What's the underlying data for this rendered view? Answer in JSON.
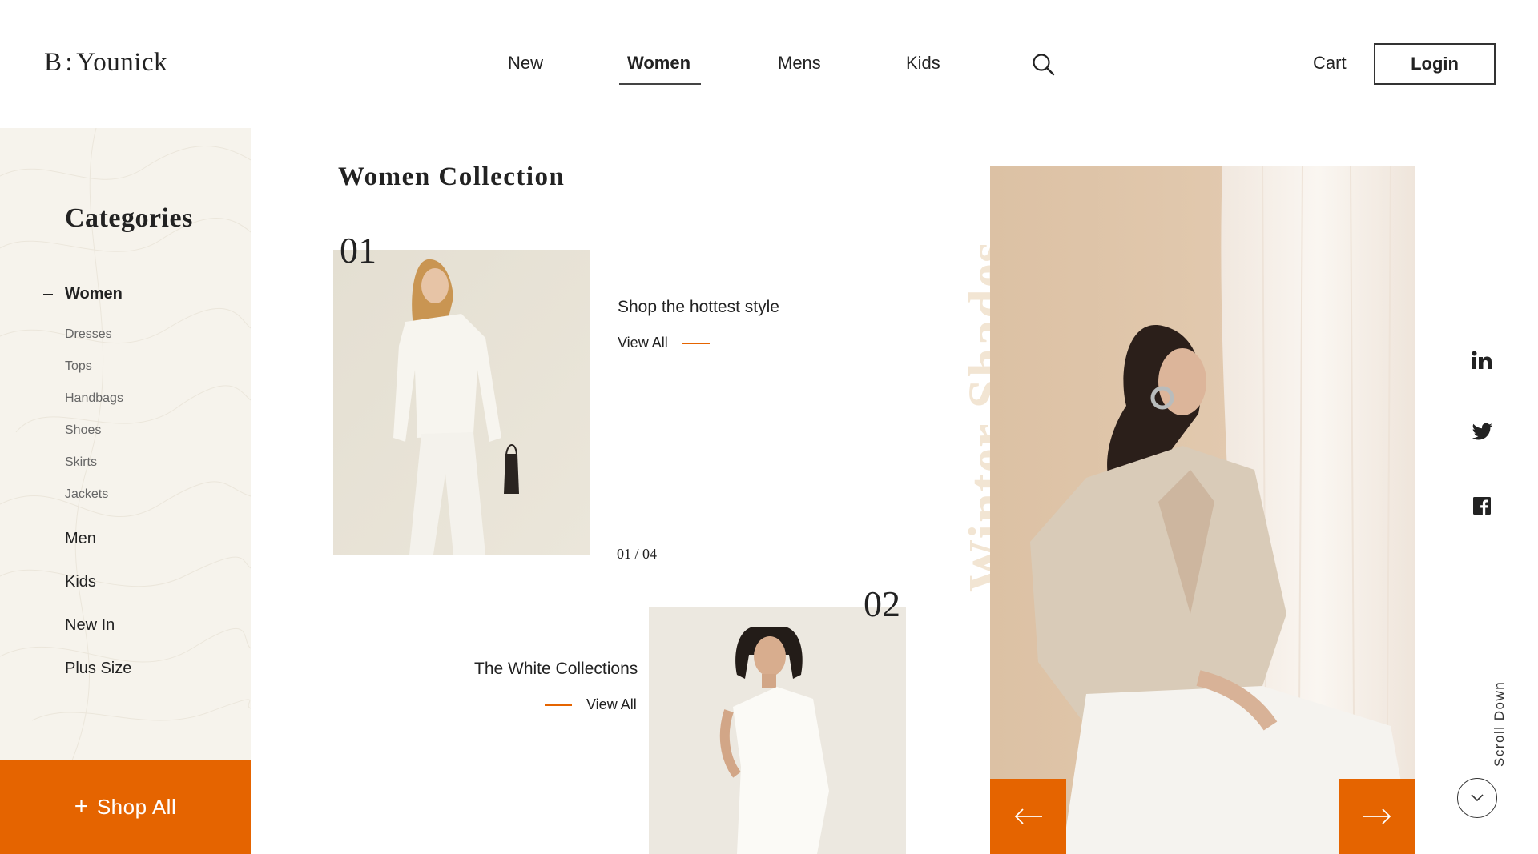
{
  "header": {
    "logo": {
      "left": "B",
      "colon": ":",
      "right": "Younick"
    },
    "nav": [
      {
        "label": "New",
        "active": false
      },
      {
        "label": "Women",
        "active": true
      },
      {
        "label": "Mens",
        "active": false
      },
      {
        "label": "Kids",
        "active": false
      }
    ],
    "search_icon": "search-icon",
    "cart_label": "Cart",
    "login_label": "Login"
  },
  "sidebar": {
    "title": "Categories",
    "expanded": {
      "label": "Women",
      "indicator": "minus",
      "children": [
        "Dresses",
        "Tops",
        "Handbags",
        "Shoes",
        "Skirts",
        "Jackets"
      ]
    },
    "items": [
      "Men",
      "Kids",
      "New In",
      "Plus Size"
    ],
    "shop_all": {
      "icon": "+",
      "label": "Shop All"
    }
  },
  "main": {
    "title": "Women Collection",
    "cards": [
      {
        "number": "01",
        "title": "Shop the hottest style",
        "link": "View All"
      },
      {
        "number": "02",
        "title": "The White Collections",
        "link": "View All"
      }
    ],
    "counter": "01 / 04"
  },
  "hero": {
    "vertical_title": "Winter Shades",
    "prev_icon": "arrow-left-icon",
    "next_icon": "arrow-right-icon"
  },
  "rail": {
    "social": [
      "linkedin-icon",
      "twitter-icon",
      "facebook-icon"
    ],
    "scroll_label": "Scroll Down",
    "scroll_icon": "chevron-down-icon"
  },
  "colors": {
    "accent": "#e56400",
    "sidebar_bg": "#f6f3ec",
    "text": "#222222",
    "vertical_title": "#f2e5d3"
  }
}
